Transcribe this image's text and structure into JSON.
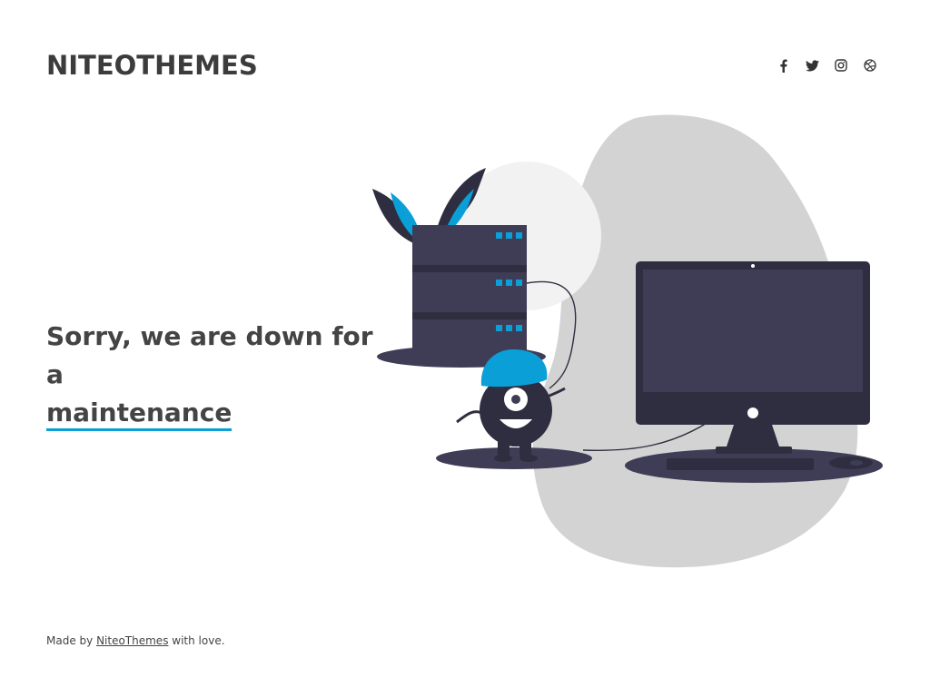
{
  "header": {
    "logo_text": "NITEOTHEMES"
  },
  "social": [
    {
      "name": "facebook",
      "icon": "facebook-icon"
    },
    {
      "name": "twitter",
      "icon": "twitter-icon"
    },
    {
      "name": "instagram",
      "icon": "instagram-icon"
    },
    {
      "name": "dribbble",
      "icon": "dribbble-icon"
    }
  ],
  "main": {
    "headline_line1": "Sorry, we are down for a",
    "headline_highlight": "maintenance"
  },
  "footer": {
    "prefix": "Made by ",
    "link_text": "NiteoThemes",
    "suffix": " with love."
  },
  "colors": {
    "accent": "#0b9fd7",
    "text": "#444444",
    "dark": "#3f3d56",
    "blob": "#d3d3d3"
  }
}
